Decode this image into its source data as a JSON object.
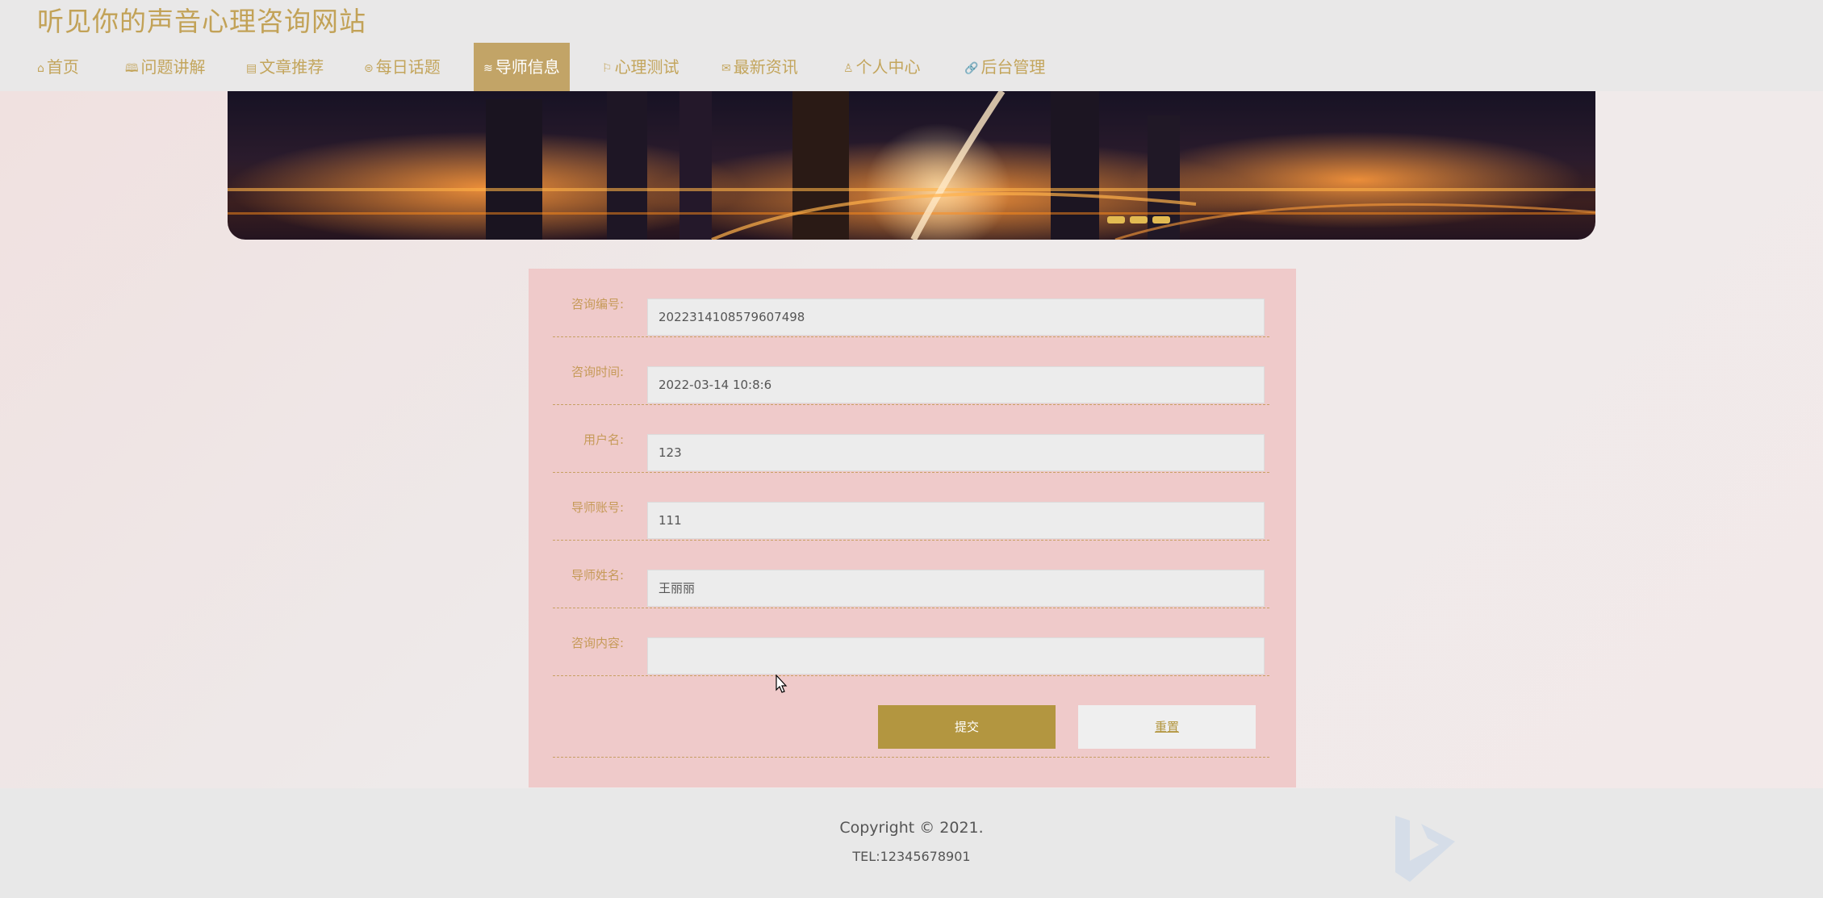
{
  "site": {
    "title": "听见你的声音心理咨询网站"
  },
  "nav": {
    "items": [
      {
        "label": "首页",
        "icon": "home-icon",
        "glyph": "⌂"
      },
      {
        "label": "问题讲解",
        "icon": "book-icon",
        "glyph": "🕮"
      },
      {
        "label": "文章推荐",
        "icon": "document-icon",
        "glyph": "▤"
      },
      {
        "label": "每日话题",
        "icon": "chat-icon",
        "glyph": "⊜"
      },
      {
        "label": "导师信息",
        "icon": "layers-icon",
        "glyph": "≋"
      },
      {
        "label": "心理测试",
        "icon": "flag-icon",
        "glyph": "⚐"
      },
      {
        "label": "最新资讯",
        "icon": "mail-icon",
        "glyph": "✉"
      },
      {
        "label": "个人中心",
        "icon": "user-icon",
        "glyph": "♙"
      },
      {
        "label": "后台管理",
        "icon": "link-icon",
        "glyph": "🔗"
      }
    ],
    "active_index": 4
  },
  "form": {
    "fields": [
      {
        "label": "咨询编号:",
        "value": "2022314108579607498"
      },
      {
        "label": "咨询时间:",
        "value": "2022-03-14 10:8:6"
      },
      {
        "label": "用户名:",
        "value": "123"
      },
      {
        "label": "导师账号:",
        "value": "111"
      },
      {
        "label": "导师姓名:",
        "value": "王丽丽"
      },
      {
        "label": "咨询内容:",
        "value": ""
      }
    ],
    "submit_label": "提交",
    "reset_label": "重置"
  },
  "footer": {
    "copyright": "Copyright © 2021.",
    "tel": "TEL:12345678901"
  },
  "colors": {
    "accent": "#c2a467",
    "button": "#b39640",
    "panel": "#efc4c4"
  }
}
